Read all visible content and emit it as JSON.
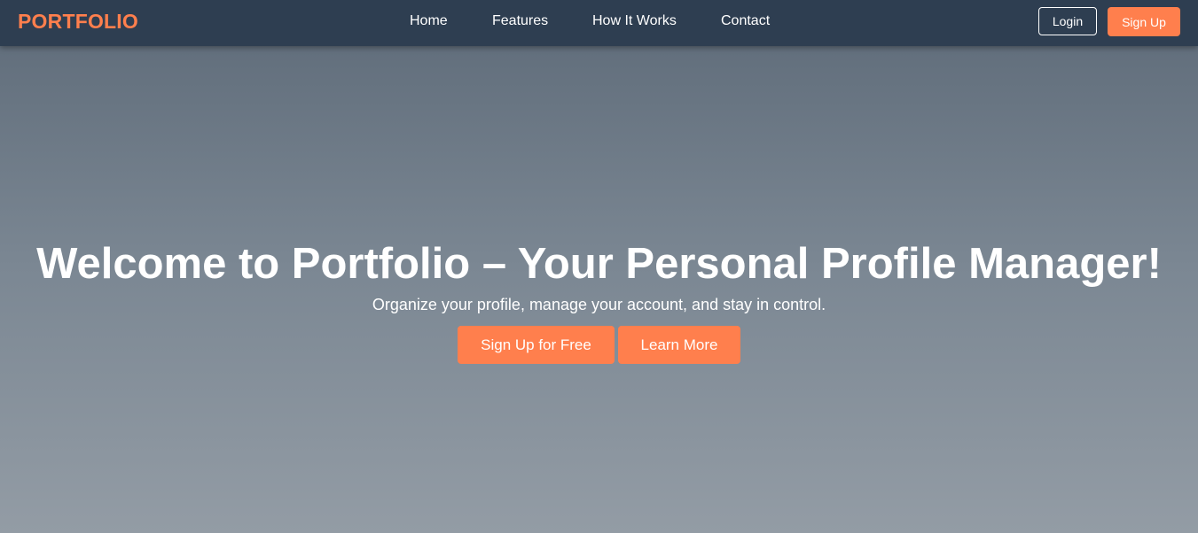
{
  "navbar": {
    "brand": "PORTFOLIO",
    "links": [
      {
        "label": "Home"
      },
      {
        "label": "Features"
      },
      {
        "label": "How It Works"
      },
      {
        "label": "Contact"
      }
    ],
    "login_label": "Login",
    "signup_label": "Sign Up"
  },
  "hero": {
    "title": "Welcome to Portfolio – Your Personal Profile Manager!",
    "subtitle": "Organize your profile, manage your account, and stay in control.",
    "primary_cta": "Sign Up for Free",
    "secondary_cta": "Learn More"
  },
  "colors": {
    "accent": "#ff7f4d",
    "navbar_bg": "#2e3e51",
    "hero_gradient_top": "#5d6a78",
    "hero_gradient_bottom": "#939ca5",
    "text": "#ffffff"
  }
}
